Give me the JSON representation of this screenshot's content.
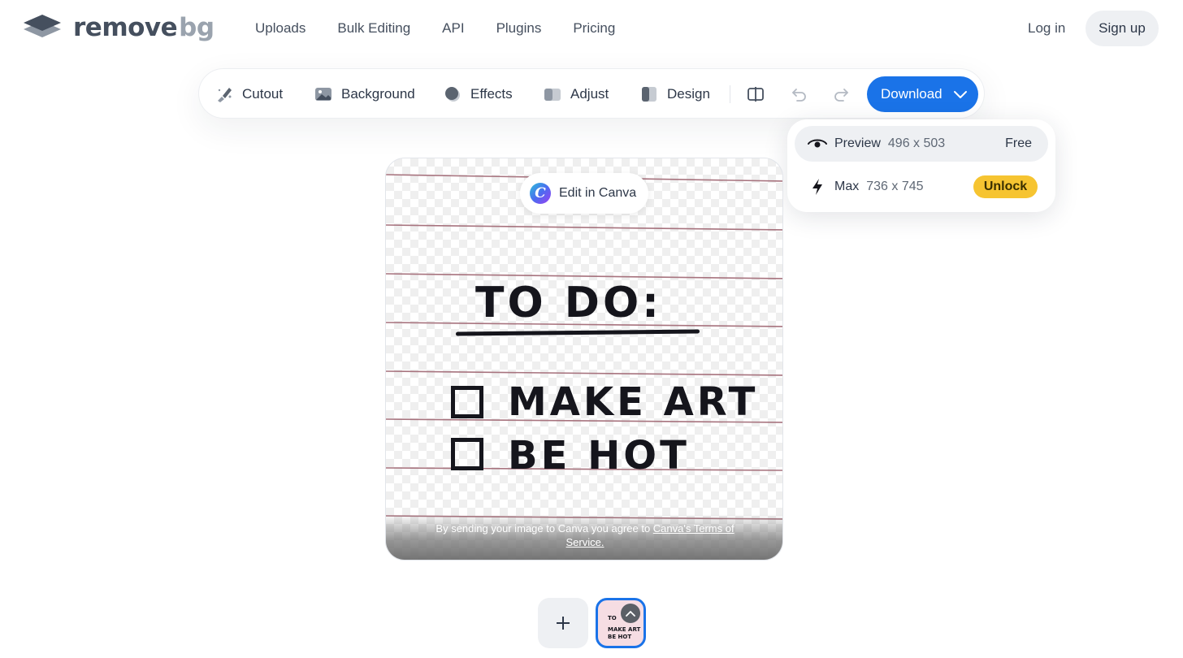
{
  "logo": {
    "part1": "remove",
    "part2": "bg"
  },
  "nav": [
    {
      "label": "Uploads"
    },
    {
      "label": "Bulk Editing"
    },
    {
      "label": "API"
    },
    {
      "label": "Plugins"
    },
    {
      "label": "Pricing"
    }
  ],
  "auth": {
    "login": "Log in",
    "signup": "Sign up"
  },
  "toolbar": {
    "cutout": "Cutout",
    "background": "Background",
    "effects": "Effects",
    "adjust": "Adjust",
    "design": "Design",
    "download": "Download"
  },
  "download_menu": {
    "preview": {
      "label": "Preview",
      "dimensions": "496 x 503",
      "price": "Free"
    },
    "max": {
      "label": "Max",
      "dimensions": "736 x 745",
      "action": "Unlock"
    }
  },
  "canvas": {
    "canva_button": "Edit in Canva",
    "terms_text": "By sending your image to Canva you agree to ",
    "terms_link": "Canva's Terms of Service.",
    "note_line1": "TO DO:",
    "note_line2": "MAKE ART",
    "note_line3": "BE HOT"
  },
  "thumbnail": {
    "line1": "TO",
    "line2": "MAKE ART",
    "line3": "BE HOT"
  },
  "colors": {
    "accent": "#1a73e8",
    "unlock": "#f6c431",
    "pill_bg": "#eef0f3"
  }
}
